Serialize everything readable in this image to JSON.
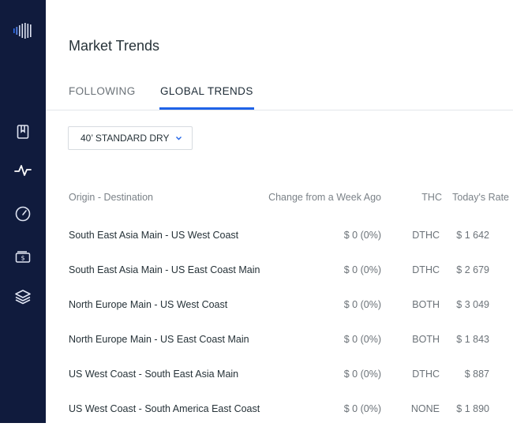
{
  "page": {
    "title": "Market Trends"
  },
  "sidebar": {
    "items": [
      {
        "icon": "bookmark-icon"
      },
      {
        "icon": "activity-icon"
      },
      {
        "icon": "gauge-icon"
      },
      {
        "icon": "wallet-icon"
      },
      {
        "icon": "layers-icon"
      }
    ]
  },
  "tabs": [
    {
      "label": "FOLLOWING",
      "active": false
    },
    {
      "label": "GLOBAL TRENDS",
      "active": true
    }
  ],
  "filter": {
    "container_type": "40’ STANDARD DRY"
  },
  "table": {
    "headers": {
      "route": "Origin - Destination",
      "change": "Change from a Week Ago",
      "thc": "THC",
      "rate": "Today's Rate"
    },
    "rows": [
      {
        "route": "South East Asia Main - US West Coast",
        "change": "$ 0 (0%)",
        "thc": "DTHC",
        "rate": "$ 1 642"
      },
      {
        "route": "South East Asia Main - US East Coast Main",
        "change": "$ 0 (0%)",
        "thc": "DTHC",
        "rate": "$ 2 679"
      },
      {
        "route": "North Europe Main - US West Coast",
        "change": "$ 0 (0%)",
        "thc": "BOTH",
        "rate": "$ 3 049"
      },
      {
        "route": "North Europe Main - US East Coast Main",
        "change": "$ 0 (0%)",
        "thc": "BOTH",
        "rate": "$ 1 843"
      },
      {
        "route": "US West Coast - South East Asia Main",
        "change": "$ 0 (0%)",
        "thc": "DTHC",
        "rate": "$ 887"
      },
      {
        "route": "US West Coast - South America East Coast",
        "change": "$ 0 (0%)",
        "thc": "NONE",
        "rate": "$ 1 890"
      }
    ]
  },
  "colors": {
    "sidebar_bg": "#101b3d",
    "accent": "#1f63e8",
    "icon": "#dfe4f2"
  }
}
